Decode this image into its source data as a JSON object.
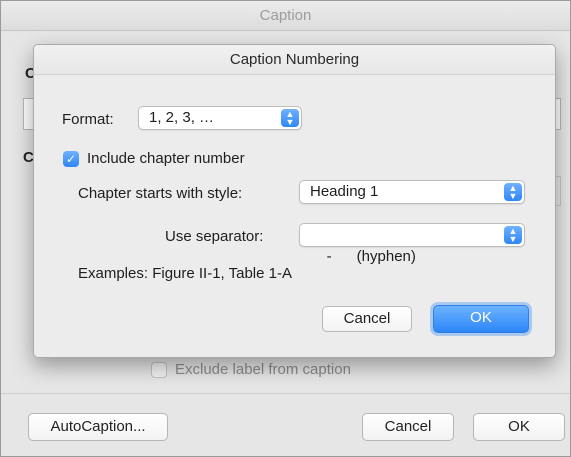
{
  "outer": {
    "title": "Caption",
    "exclude_label": "Exclude label from caption",
    "autocaption_label": "AutoCaption...",
    "cancel_label": "Cancel",
    "ok_label": "OK"
  },
  "sheet": {
    "title": "Caption Numbering",
    "format_label": "Format:",
    "format_value": "1, 2, 3, …",
    "include_chapter_label": "Include chapter number",
    "include_chapter_checked": true,
    "chapter_style_label": "Chapter starts with style:",
    "chapter_style_value": "Heading 1",
    "separator_label": "Use separator:",
    "separator_value": "-      (hyphen)",
    "examples_text": "Examples:  Figure II-1, Table 1-A",
    "cancel_label": "Cancel",
    "ok_label": "OK"
  },
  "colors": {
    "accent": "#2f86f6",
    "sheet_bg": "#ececec",
    "outer_bg": "#e6e6e6"
  }
}
